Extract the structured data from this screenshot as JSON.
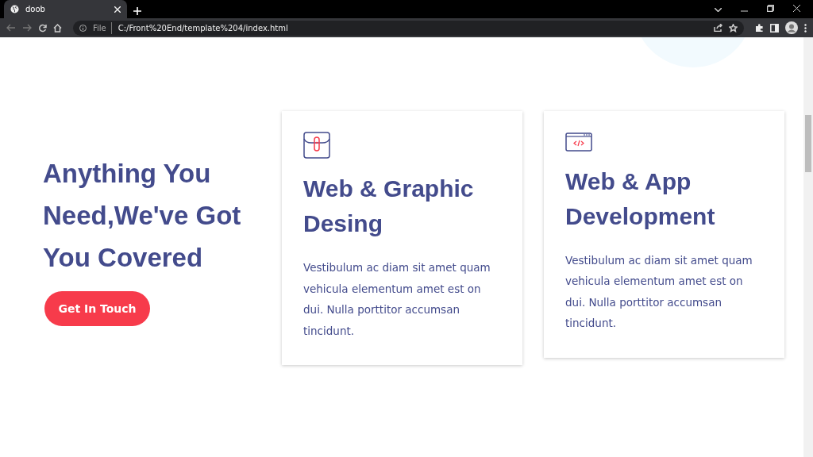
{
  "browser": {
    "tab_title": "doob",
    "url_scheme": "File",
    "url": "C:/Front%20End/template%204/index.html"
  },
  "hero": {
    "heading": "Anything You Need,We've Got You Covered",
    "button": "Get In Touch"
  },
  "cards": [
    {
      "kind": "envelope",
      "title": "Web & Graphic Desing",
      "text": "Vestibulum ac diam sit amet quam vehicula elementum amet est on dui. Nulla porttitor accumsan tincidunt."
    },
    {
      "kind": "code",
      "title": "Web & App Development",
      "text": "Vestibulum ac diam sit amet quam vehicula elementum amet est on dui. Nulla porttitor accumsan tincidunt."
    }
  ]
}
